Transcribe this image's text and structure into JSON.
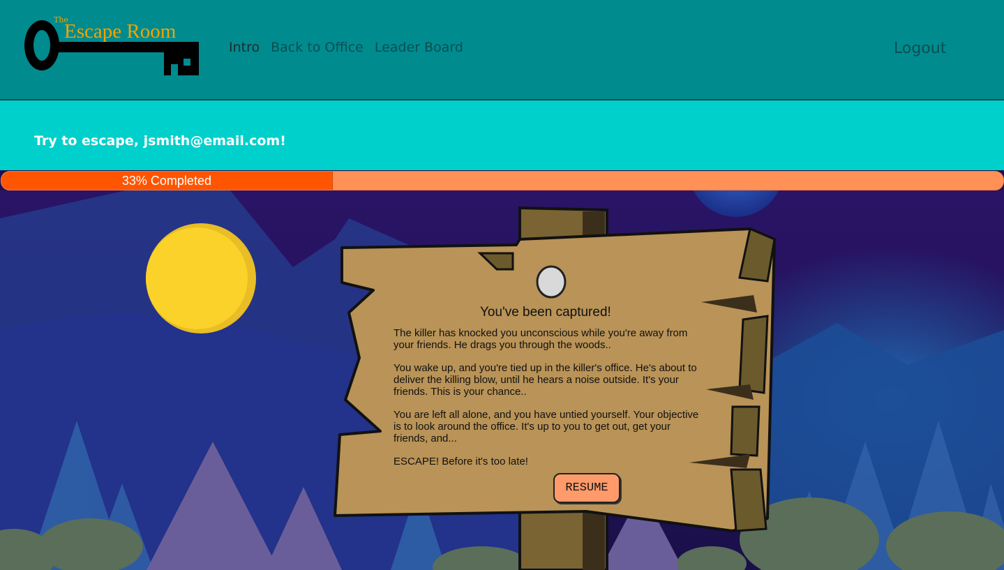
{
  "logo": {
    "the": "The",
    "title": "Escape Room"
  },
  "nav": {
    "items": [
      "Intro",
      "Back to Office",
      "Leader Board"
    ]
  },
  "logout_label": "Logout",
  "banner": {
    "text": "Try to escape, jsmith@email.com!"
  },
  "progress": {
    "percent": 33,
    "label": "33% Completed"
  },
  "story": {
    "title": "You've been captured!",
    "paragraphs": [
      "The killer has knocked you unconscious while you're away from your friends. He drags you through the woods..",
      "You wake up, and you're tied up in the killer's office. He's about to deliver the killing blow, until he hears a noise outside. It's your friends. This is your chance..",
      "You are left all alone, and you have untied yourself. Your objective is to look around the office. It's up to you to get out, get your friends, and...",
      "ESCAPE! Before it's too late!"
    ],
    "button_label": "RESUME"
  },
  "colors": {
    "header": "#008b8f",
    "banner": "#00d0cb",
    "progress_fill": "#ff5500",
    "progress_track": "#ff9156",
    "sign": "#b99357",
    "moon": "#fbd22a"
  }
}
